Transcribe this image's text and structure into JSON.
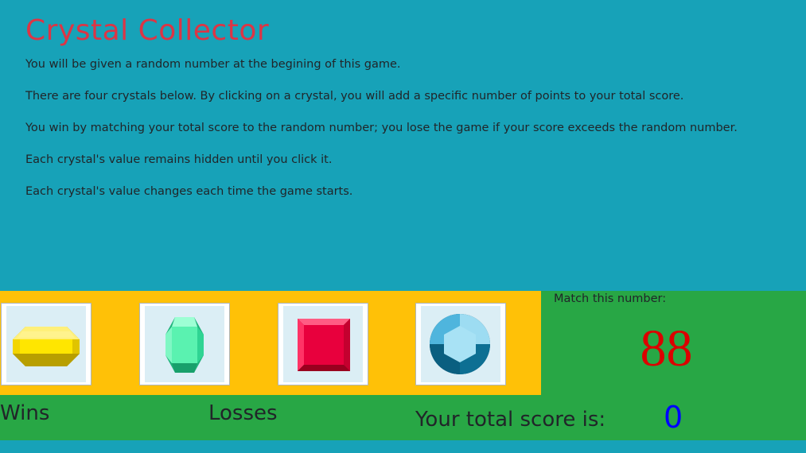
{
  "header": {
    "title": "Crystal Collector"
  },
  "instructions": [
    "You will be given a random number at the begining of this game.",
    "There are four crystals below. By clicking on a crystal, you will add a specific number of points to your total score.",
    "You win by matching your total score to the random number; you lose the game if your score exceeds the random number.",
    "Each crystal's value remains hidden until you click it.",
    "Each crystal's value changes each time the game starts."
  ],
  "crystals": [
    {
      "icon": "yellow-octagon-gem-icon",
      "color": "#ffe600"
    },
    {
      "icon": "green-hexagon-gem-icon",
      "color": "#5af2b0"
    },
    {
      "icon": "red-square-gem-icon",
      "color": "#e8003d"
    },
    {
      "icon": "blue-round-gem-icon",
      "color": "#6cc8ea"
    }
  ],
  "target": {
    "label": "Match this number:",
    "value": "88"
  },
  "stats": {
    "wins_label": "Wins",
    "losses_label": "Losses",
    "score_label": "Your total score is:",
    "score_value": "0"
  },
  "colors": {
    "background": "#17a2b8",
    "crystal_bar": "#ffc107",
    "panel": "#28a745",
    "title": "#dc3545",
    "target_number": "#dc0000",
    "score_value": "#0000ff"
  }
}
